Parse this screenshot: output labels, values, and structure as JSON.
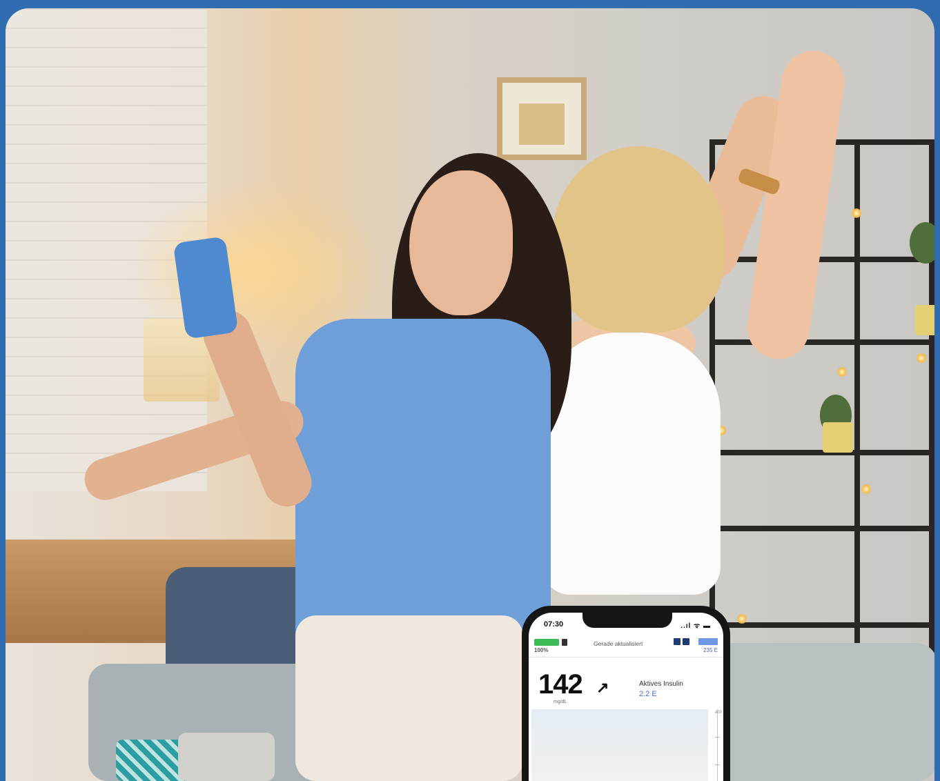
{
  "phone": {
    "time": "07:30",
    "status_icons": "..ıl ᯤ ▬",
    "battery_percent": "100%",
    "update_status": "Gerade aktualisiert",
    "reservoir": "235 E",
    "glucose_value": "142",
    "glucose_trend": "↗",
    "glucose_unit": "mg/dL",
    "active_insulin_label": "Aktives Insulin",
    "active_insulin_value": "2.2 E",
    "graph_axis_label": "400"
  },
  "scene": {
    "background_color": "#2f6db0"
  }
}
